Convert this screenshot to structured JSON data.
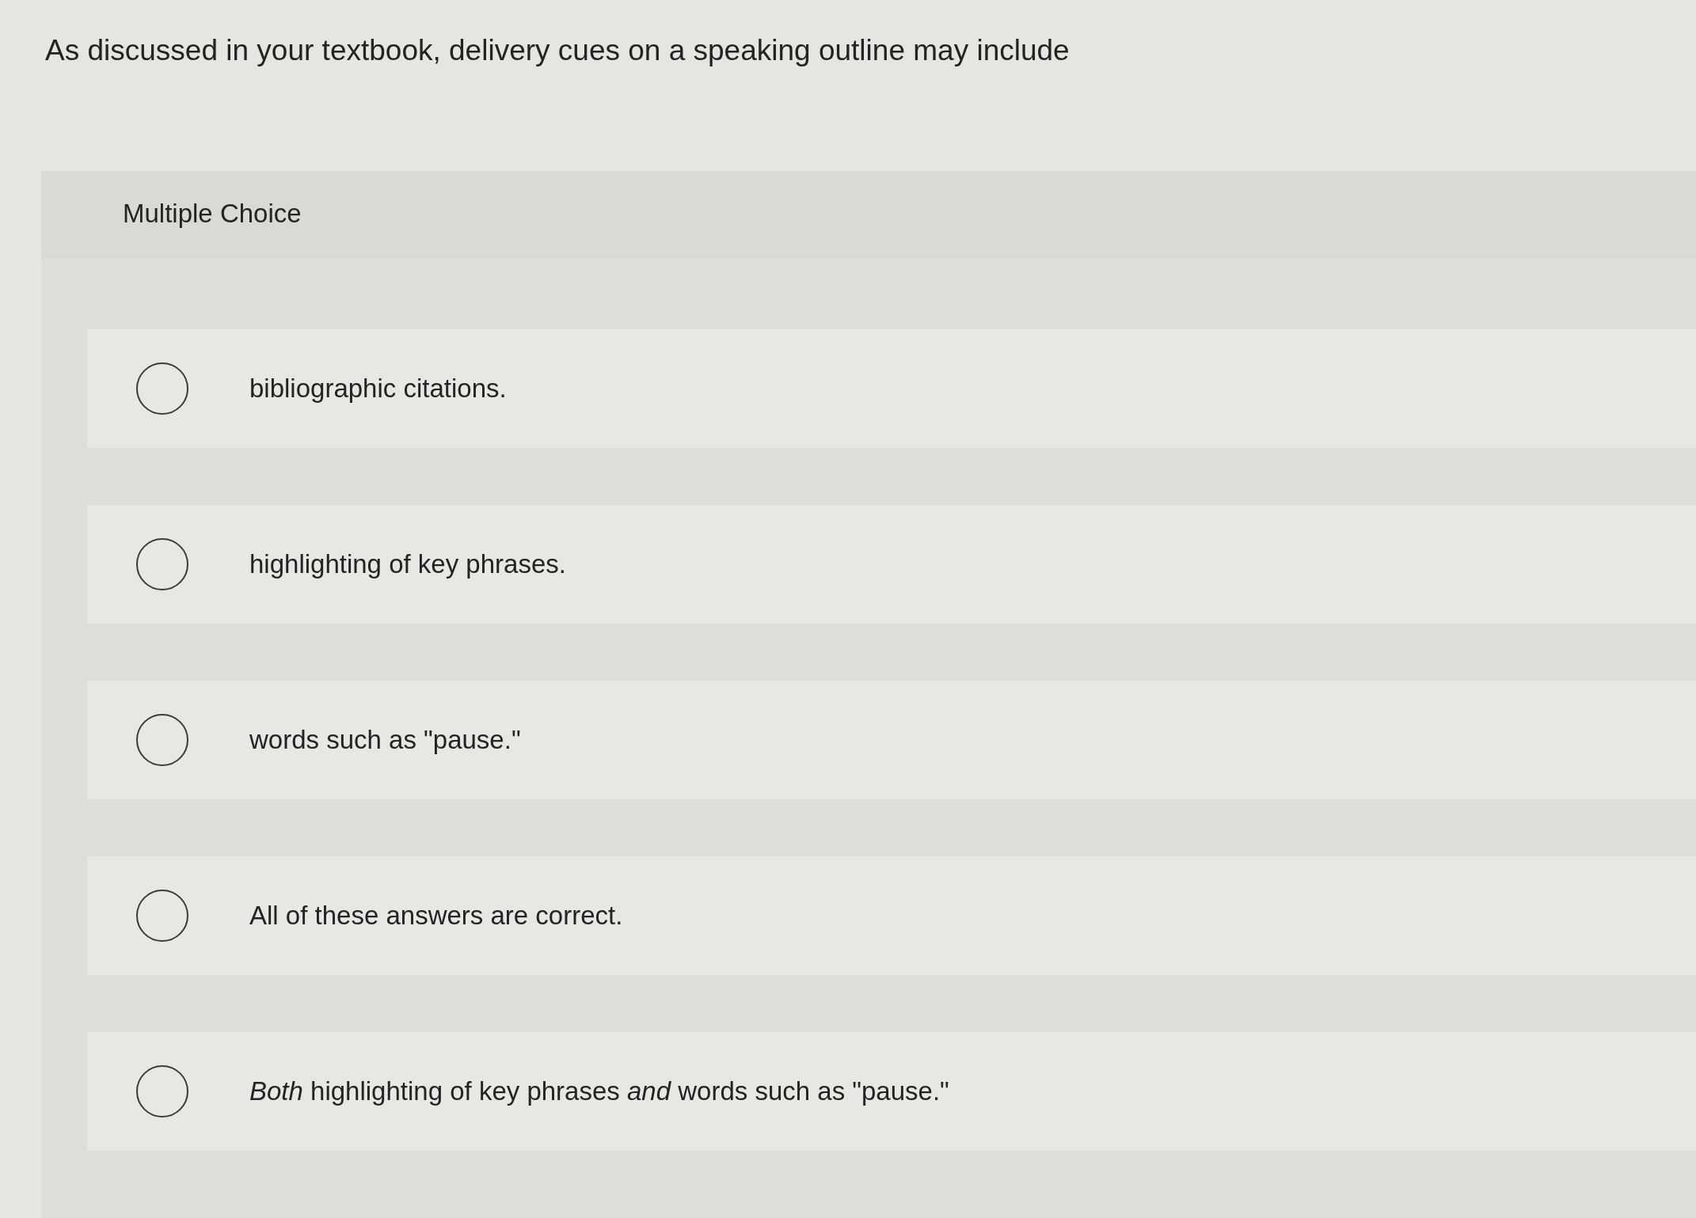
{
  "question": "As discussed in your textbook, delivery cues on a speaking outline may include",
  "panel": {
    "heading": "Multiple Choice",
    "options": [
      {
        "text": "bibliographic citations.",
        "selected": false
      },
      {
        "text": "highlighting of key phrases.",
        "selected": false
      },
      {
        "text": "words such as \"pause.\"",
        "selected": false
      },
      {
        "text": "All of these answers are correct.",
        "selected": false
      },
      {
        "text": "*Both* highlighting of key phrases *and* words such as \"pause.\"",
        "selected": false
      }
    ]
  }
}
